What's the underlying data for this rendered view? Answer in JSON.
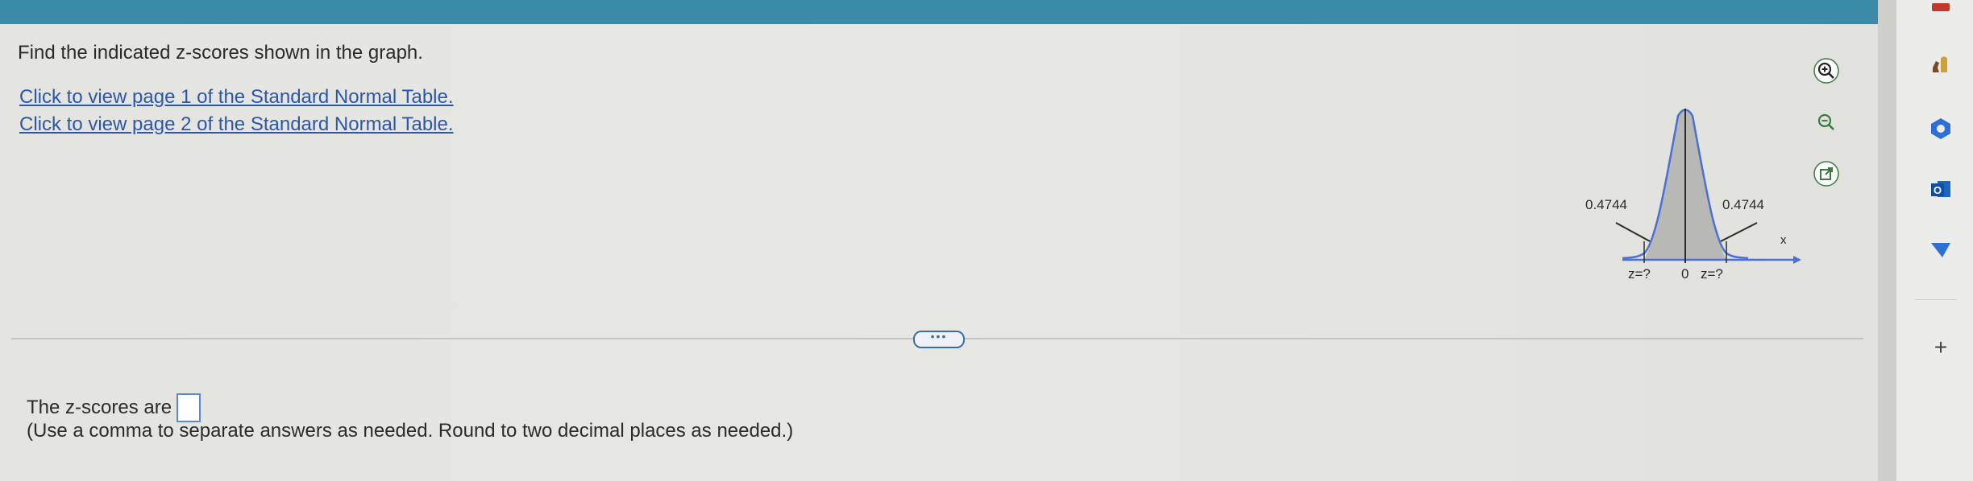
{
  "question": {
    "prompt": "Find the indicated z-scores shown in the graph.",
    "link1": "Click to view page 1 of the Standard Normal Table.",
    "link2": "Click to view page 2 of the Standard Normal Table."
  },
  "graph": {
    "left_area": "0.4744",
    "right_area": "0.4744",
    "axis_label": "x",
    "left_z": "z=?",
    "center": "0",
    "right_z": "z=?",
    "curve_color": "#4a6fd6",
    "fill_color": "#b8b8b4"
  },
  "tools": {
    "zoom_in": "zoom-in-icon",
    "zoom_out": "zoom-out-icon",
    "popout": "external-link-icon"
  },
  "divider": {
    "expand_label": "•••"
  },
  "answer": {
    "prefix": "The z-scores are",
    "hint": "(Use a comma to separate answers as needed. Round to two decimal places as needed.)"
  },
  "sidebar": {
    "icons": [
      "chess-icon",
      "copilot-icon",
      "outlook-icon",
      "send-icon",
      "plus-icon"
    ],
    "plus_label": "+"
  },
  "colors": {
    "topbar": "#3a8aa8",
    "link": "#2d56a8",
    "accent": "#3b6ea7"
  }
}
